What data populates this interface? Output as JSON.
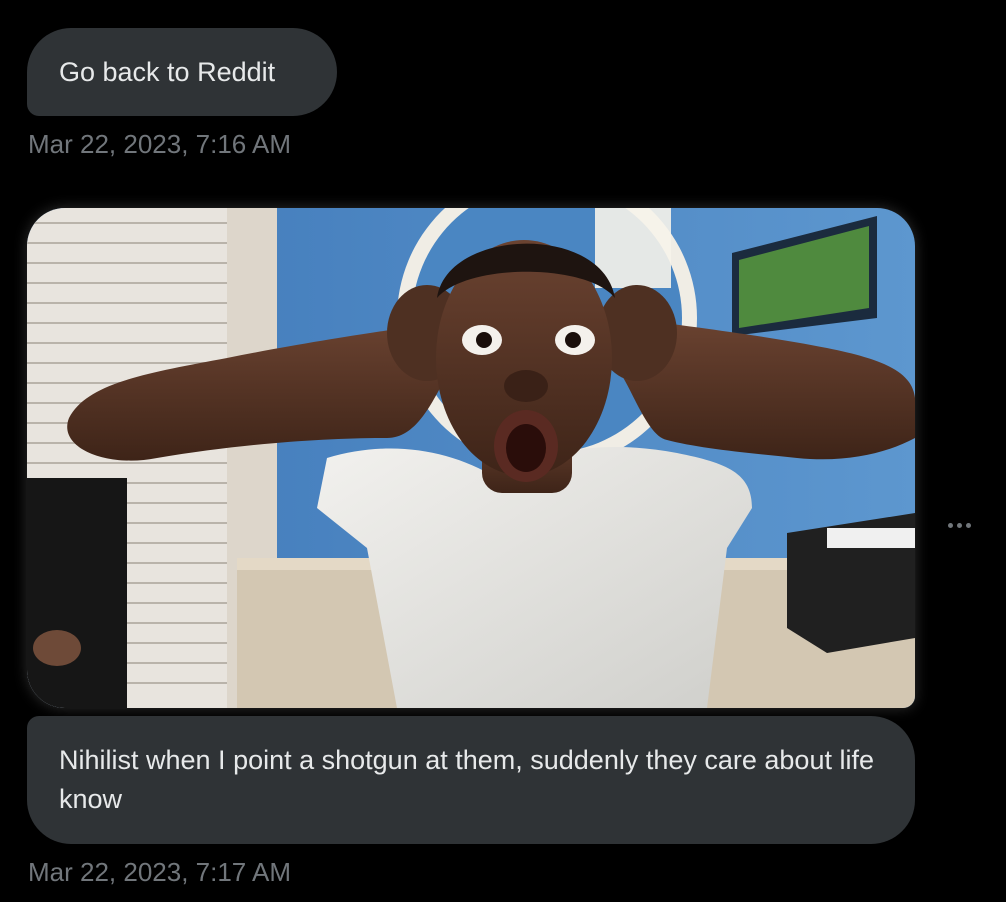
{
  "messages": [
    {
      "text": "Go back to Reddit",
      "timestamp": "Mar 22, 2023, 7:16 AM"
    },
    {
      "image_description_icon": "photo-icon",
      "text": "Nihilist when I point a shotgun at them, suddenly they care about life know",
      "timestamp": "Mar 22, 2023, 7:17 AM"
    }
  ],
  "colors": {
    "background": "#000000",
    "bubble": "#2f3336",
    "text": "#e7e9ea",
    "timestamp": "#71767b"
  },
  "more_icon": "more-horizontal-icon"
}
